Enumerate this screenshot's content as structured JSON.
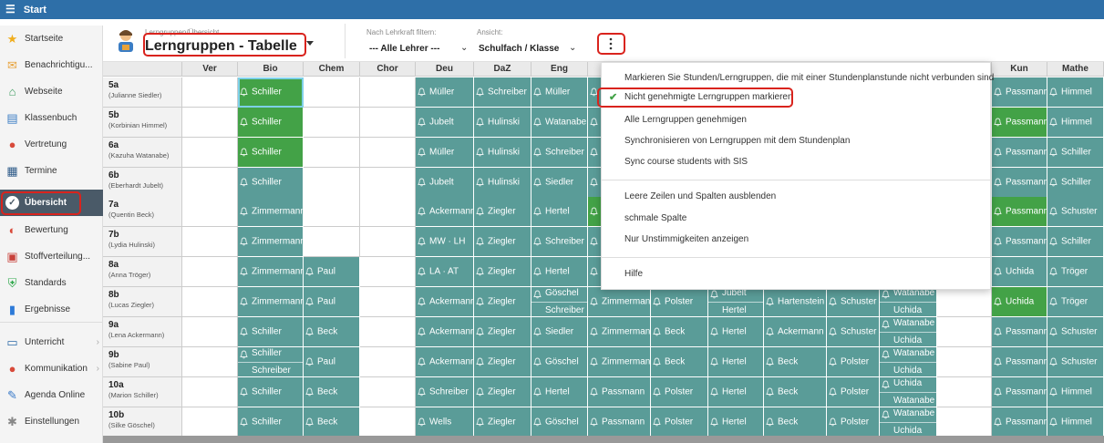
{
  "topbar": {
    "title": "Start"
  },
  "sidebar": {
    "items": [
      {
        "label": "Startseite",
        "icon": "star-icon",
        "color": "#f0ad1c"
      },
      {
        "label": "Benachrichtigu...",
        "icon": "envelope-icon",
        "color": "#e8a23a"
      },
      {
        "label": "Webseite",
        "icon": "home-icon",
        "color": "#3a9a5c"
      },
      {
        "label": "Klassenbuch",
        "icon": "book-icon",
        "color": "#3b7dc4"
      },
      {
        "label": "Vertretung",
        "icon": "person-icon",
        "color": "#d84a3a"
      },
      {
        "label": "Termine",
        "icon": "calendar-icon",
        "color": "#2d5a88"
      },
      {
        "label": "Übersicht",
        "icon": "check-circle-icon",
        "color": "#ffffff"
      },
      {
        "label": "Bewertung",
        "icon": "gauge-icon",
        "color": "#d84a3a"
      },
      {
        "label": "Stoffverteilung...",
        "icon": "clipboard-icon",
        "color": "#c8413a"
      },
      {
        "label": "Standards",
        "icon": "shield-icon",
        "color": "#2da84a"
      },
      {
        "label": "Ergebnisse",
        "icon": "bar-chart-icon",
        "color": "#2d7ad8"
      },
      {
        "label": "Unterricht",
        "icon": "monitor-icon",
        "color": "#2d6aa8"
      },
      {
        "label": "Kommunikation",
        "icon": "chat-icon",
        "color": "#d84a3a"
      },
      {
        "label": "Agenda Online",
        "icon": "pen-icon",
        "color": "#3a7ac8"
      },
      {
        "label": "Einstellungen",
        "icon": "gear-icon",
        "color": "#888888"
      }
    ]
  },
  "header": {
    "subtitle": "Lerngruppen/Übersicht",
    "title": "Lerngruppen - Tabelle",
    "filter_label": "Nach Lehrkraft filtern:",
    "filter_value": "--- Alle Lehrer ---",
    "view_label": "Ansicht:",
    "view_value": "Schulfach / Klasse"
  },
  "columns": [
    "Ver",
    "Bio",
    "Chem",
    "Chor",
    "Deu",
    "DaZ",
    "Eng",
    "",
    "",
    "",
    "",
    "",
    "",
    "",
    "",
    "Kun",
    "Mathe"
  ],
  "rows": [
    {
      "cls": "5a",
      "teacher": "(Julianne Siedler)"
    },
    {
      "cls": "5b",
      "teacher": "(Korbinian Himmel)"
    },
    {
      "cls": "6a",
      "teacher": "(Kazuha Watanabe)"
    },
    {
      "cls": "6b",
      "teacher": "(Eberhardt Jubelt)"
    },
    {
      "cls": "7a",
      "teacher": "(Quentin Beck)"
    },
    {
      "cls": "7b",
      "teacher": "(Lydia Hulinski)"
    },
    {
      "cls": "8a",
      "teacher": "(Anna Tröger)"
    },
    {
      "cls": "8b",
      "teacher": "(Lucas Ziegler)"
    },
    {
      "cls": "9a",
      "teacher": "(Lena Ackermann)"
    },
    {
      "cls": "9b",
      "teacher": "(Sabine Paul)"
    },
    {
      "cls": "10a",
      "teacher": "(Marion Schiller)"
    },
    {
      "cls": "10b",
      "teacher": "(Silke Göschel)"
    }
  ],
  "cells": [
    [
      "w",
      [
        "g",
        "Schiller"
      ],
      "w",
      "w",
      [
        "t",
        "Müller"
      ],
      [
        "t",
        "Schreiber"
      ],
      [
        "t",
        "Müller"
      ],
      [
        "t",
        ""
      ],
      null,
      null,
      null,
      null,
      null,
      null,
      null,
      [
        "t",
        "Passmann"
      ],
      [
        "t",
        "Himmel"
      ]
    ],
    [
      "w",
      [
        "g",
        "Schiller"
      ],
      "w",
      "w",
      [
        "t",
        "Jubelt"
      ],
      [
        "t",
        "Hulinski"
      ],
      [
        "t",
        "Watanabe"
      ],
      [
        "t",
        ""
      ],
      null,
      null,
      null,
      null,
      null,
      null,
      null,
      [
        "g",
        "Passmann"
      ],
      [
        "t",
        "Himmel"
      ]
    ],
    [
      "w",
      [
        "g",
        "Schiller"
      ],
      "w",
      "w",
      [
        "t",
        "Müller"
      ],
      [
        "t",
        "Hulinski"
      ],
      [
        "t",
        "Schreiber"
      ],
      [
        "t",
        ""
      ],
      null,
      null,
      null,
      null,
      null,
      null,
      null,
      [
        "t",
        "Passmann"
      ],
      [
        "t",
        "Schiller"
      ]
    ],
    [
      "w",
      [
        "t",
        "Schiller"
      ],
      "w",
      "w",
      [
        "t",
        "Jubelt"
      ],
      [
        "t",
        "Hulinski"
      ],
      [
        "t",
        "Siedler"
      ],
      [
        "t",
        ""
      ],
      null,
      null,
      null,
      null,
      null,
      null,
      null,
      [
        "t",
        "Passmann"
      ],
      [
        "t",
        "Schiller"
      ]
    ],
    [
      "w",
      [
        "t",
        "Zimmermann"
      ],
      "w",
      "w",
      [
        "t",
        "Ackermann"
      ],
      [
        "t",
        "Ziegler"
      ],
      [
        "t",
        "Hertel"
      ],
      [
        "g",
        ""
      ],
      null,
      null,
      null,
      null,
      null,
      null,
      null,
      [
        "g",
        "Passmann"
      ],
      [
        "t",
        "Schuster"
      ]
    ],
    [
      "w",
      [
        "t",
        "Zimmermann"
      ],
      "w",
      "w",
      [
        "t",
        "MW · LH"
      ],
      [
        "t",
        "Ziegler"
      ],
      [
        "t",
        "Schreiber"
      ],
      [
        "t",
        ""
      ],
      null,
      null,
      null,
      null,
      null,
      null,
      null,
      [
        "t",
        "Passmann"
      ],
      [
        "t",
        "Schiller"
      ]
    ],
    [
      "w",
      [
        "t",
        "Zimmermann"
      ],
      [
        "t",
        "Paul"
      ],
      "w",
      [
        "t",
        "LA · AT"
      ],
      [
        "t",
        "Ziegler"
      ],
      [
        "t",
        "Hertel"
      ],
      [
        "t",
        ""
      ],
      null,
      null,
      null,
      null,
      null,
      null,
      null,
      [
        "t",
        "Uchida"
      ],
      [
        "t",
        "Tröger"
      ]
    ],
    [
      "w",
      [
        "t",
        "Zimmermann"
      ],
      [
        "t",
        "Paul"
      ],
      "w",
      [
        "t",
        "Ackermann"
      ],
      [
        "t",
        "Ziegler"
      ],
      [
        "t",
        "Göschel",
        "Schreiber"
      ],
      [
        "t",
        "Zimmermann"
      ],
      [
        "t",
        "Polster"
      ],
      [
        "t",
        "Jubelt",
        "Hertel"
      ],
      [
        "t",
        "Hartenstein"
      ],
      [
        "t",
        "Schuster"
      ],
      [
        "t",
        "Watanabe",
        "Uchida"
      ],
      "w",
      null,
      [
        "g",
        "Uchida"
      ],
      [
        "t",
        "Tröger"
      ]
    ],
    [
      "w",
      [
        "t",
        "Schiller"
      ],
      [
        "t",
        "Beck"
      ],
      "w",
      [
        "t",
        "Ackermann"
      ],
      [
        "t",
        "Ziegler"
      ],
      [
        "t",
        "Siedler"
      ],
      [
        "t",
        "Zimmermann"
      ],
      [
        "t",
        "Beck"
      ],
      [
        "t",
        "Hertel"
      ],
      [
        "t",
        "Ackermann"
      ],
      [
        "t",
        "Schuster"
      ],
      [
        "t",
        "Watanabe",
        "Uchida"
      ],
      "w",
      null,
      [
        "t",
        "Passmann"
      ],
      [
        "t",
        "Schuster"
      ]
    ],
    [
      "w",
      [
        "t",
        "Schiller",
        "Schreiber"
      ],
      [
        "t",
        "Paul"
      ],
      "w",
      [
        "t",
        "Ackermann"
      ],
      [
        "t",
        "Ziegler"
      ],
      [
        "t",
        "Göschel"
      ],
      [
        "t",
        "Zimmermann"
      ],
      [
        "t",
        "Beck"
      ],
      [
        "t",
        "Hertel"
      ],
      [
        "t",
        "Beck"
      ],
      [
        "t",
        "Polster"
      ],
      [
        "t",
        "Watanabe",
        "Uchida"
      ],
      "w",
      null,
      [
        "t",
        "Passmann"
      ],
      [
        "t",
        "Schuster"
      ]
    ],
    [
      "w",
      [
        "t",
        "Schiller"
      ],
      [
        "t",
        "Beck"
      ],
      "w",
      [
        "t",
        "Schreiber"
      ],
      [
        "t",
        "Ziegler"
      ],
      [
        "t",
        "Hertel"
      ],
      [
        "t",
        "Passmann"
      ],
      [
        "t",
        "Polster"
      ],
      [
        "t",
        "Hertel"
      ],
      [
        "t",
        "Beck"
      ],
      [
        "t",
        "Polster"
      ],
      [
        "t",
        "Uchida",
        "Watanabe"
      ],
      "w",
      null,
      [
        "t",
        "Passmann"
      ],
      [
        "t",
        "Himmel"
      ]
    ],
    [
      "w",
      [
        "t",
        "Schiller"
      ],
      [
        "t",
        "Beck"
      ],
      "w",
      [
        "t",
        "Wells"
      ],
      [
        "t",
        "Ziegler"
      ],
      [
        "t",
        "Göschel"
      ],
      [
        "t",
        "Passmann"
      ],
      [
        "t",
        "Polster"
      ],
      [
        "t",
        "Hertel"
      ],
      [
        "t",
        "Beck"
      ],
      [
        "t",
        "Polster"
      ],
      [
        "t",
        "Watanabe",
        "Uchida"
      ],
      "w",
      null,
      [
        "t",
        "Passmann"
      ],
      [
        "t",
        "Himmel"
      ]
    ]
  ],
  "menu": {
    "items": [
      "Markieren Sie Stunden/Lerngruppen, die mit einer Stundenplanstunde nicht verbunden sind",
      "Nicht genehmigte Lerngruppen markieren",
      "Alle Lerngruppen genehmigen",
      "Synchronisieren von Lerngruppen mit dem Stundenplan",
      "Sync course students with SIS",
      "Leere Zeilen und Spalten ausblenden",
      "schmale Spalte",
      "Nur Unstimmigkeiten anzeigen",
      "Hilfe"
    ],
    "checked_index": 1
  },
  "colors": {
    "teal": "#5a9c98",
    "green": "#43a247",
    "topbar": "#2e6fa8",
    "highlight": "#d9231d"
  }
}
